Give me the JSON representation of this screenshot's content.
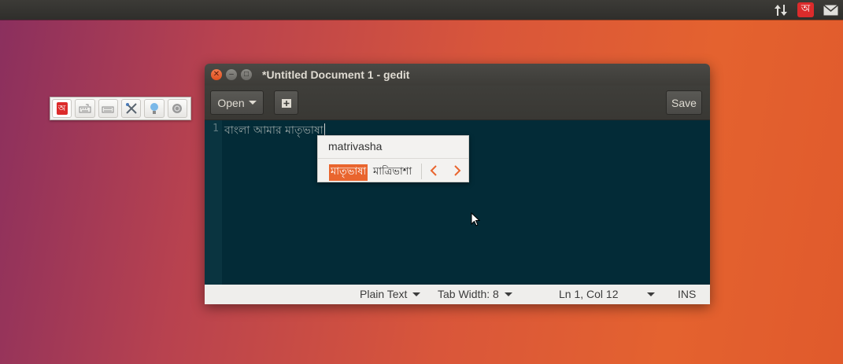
{
  "top_panel": {
    "icons": [
      "network-icon",
      "input-method-icon",
      "mail-icon"
    ],
    "input_method_glyph": "অ"
  },
  "input_toolbar": {
    "language_glyph": "অ",
    "icons": [
      "bengali-language-icon",
      "keyboard-mode-icon",
      "keyboard-layout-icon",
      "settings-tools-icon",
      "help-bulb-icon",
      "about-icon"
    ]
  },
  "window": {
    "title": "*Untitled Document 1 - gedit",
    "toolbar": {
      "open_label": "Open",
      "save_label": "Save"
    },
    "editor": {
      "line_number": "1",
      "text": "বাংলা আমার মাতৃভাষা"
    },
    "statusbar": {
      "language": "Plain Text",
      "tab_width": "Tab Width: 8",
      "position": "Ln 1, Col 12",
      "mode": "INS"
    }
  },
  "completion_popup": {
    "preedit": "matrivasha",
    "candidates": [
      "মাতৃভাষা",
      "মাত্রিভাশা"
    ],
    "selected_index": 0
  },
  "colors": {
    "accent": "#e9652e",
    "editor_background": "#032b37",
    "input_method_red": "#dc2b2b"
  }
}
